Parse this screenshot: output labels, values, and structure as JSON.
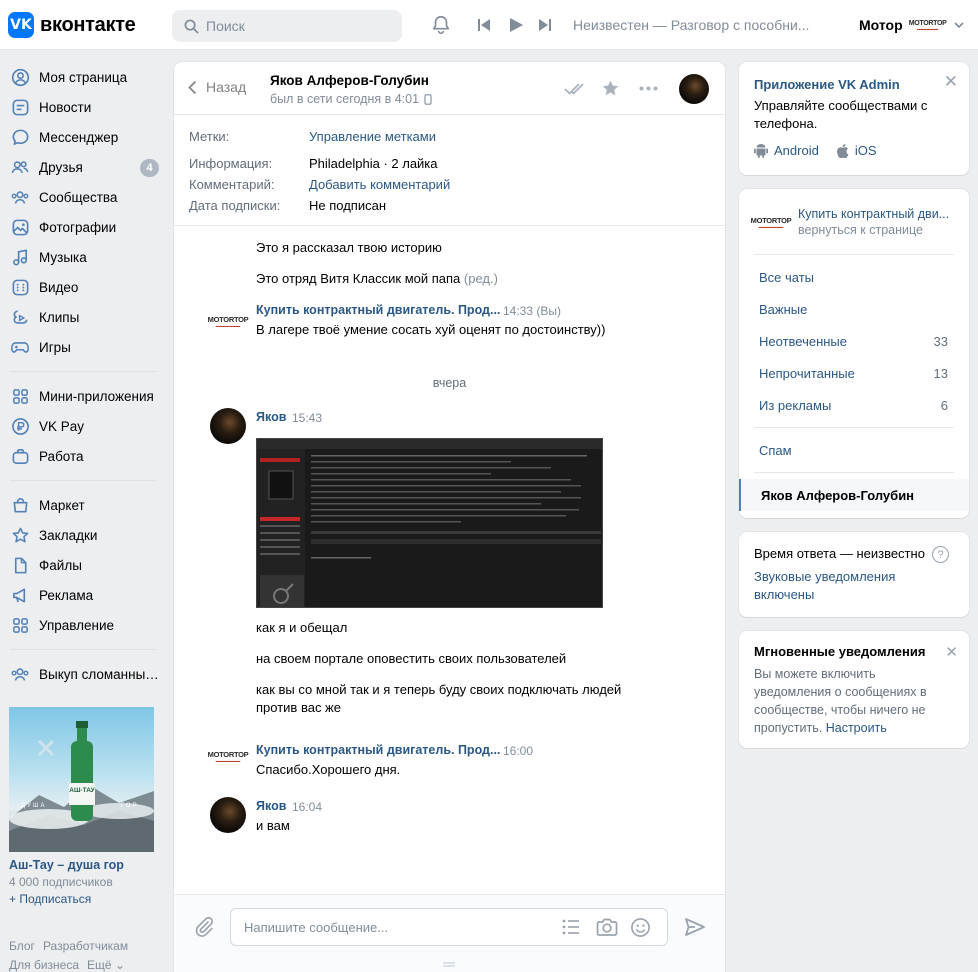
{
  "header": {
    "logo_text": "вконтакте",
    "search_placeholder": "Поиск",
    "track": "Неизвестен — Разговор с пособни...",
    "profile_name": "Мотор"
  },
  "leftnav": {
    "items": [
      {
        "label": "Моя страница",
        "icon": "user-circle-icon"
      },
      {
        "label": "Новости",
        "icon": "news-icon"
      },
      {
        "label": "Мессенджер",
        "icon": "message-icon"
      },
      {
        "label": "Друзья",
        "icon": "friends-icon",
        "badge": "4"
      },
      {
        "label": "Сообщества",
        "icon": "communities-icon"
      },
      {
        "label": "Фотографии",
        "icon": "photos-icon"
      },
      {
        "label": "Музыка",
        "icon": "music-icon"
      },
      {
        "label": "Видео",
        "icon": "video-icon"
      },
      {
        "label": "Клипы",
        "icon": "clips-icon"
      },
      {
        "label": "Игры",
        "icon": "games-icon"
      }
    ],
    "items2": [
      {
        "label": "Мини-приложения",
        "icon": "apps-icon"
      },
      {
        "label": "VK Pay",
        "icon": "vkpay-icon"
      },
      {
        "label": "Работа",
        "icon": "work-icon"
      }
    ],
    "items3": [
      {
        "label": "Маркет",
        "icon": "market-icon"
      },
      {
        "label": "Закладки",
        "icon": "bookmark-icon"
      },
      {
        "label": "Файлы",
        "icon": "file-icon"
      },
      {
        "label": "Реклама",
        "icon": "ads-icon"
      },
      {
        "label": "Управление",
        "icon": "manage-icon"
      }
    ],
    "items4": [
      {
        "label": "Выкуп сломанных...",
        "icon": "communities-icon"
      }
    ]
  },
  "promo": {
    "image_caption_left": "ДУША",
    "image_caption_right": "ГОР",
    "bottle_label": "АШ-ТАУ",
    "title": "Аш-Тау – душа гор",
    "subscribers": "4 000 подписчиков",
    "subscribe": "+ Подписаться"
  },
  "footer": {
    "links": [
      "Блог",
      "Разработчикам",
      "Для бизнеса",
      "Ещё ⌄"
    ]
  },
  "chat": {
    "back": "Назад",
    "peer_name": "Яков Алферов-Голубин",
    "peer_status": "был в сети сегодня в 4:01",
    "info": {
      "tags_label": "Метки:",
      "tags_value": "Управление метками",
      "info_label": "Информация:",
      "info_value": "Philadelphia · 2 лайка",
      "comment_label": "Комментарий:",
      "comment_value": "Добавить комментарий",
      "sub_label": "Дата подписки:",
      "sub_value": "Не подписан"
    },
    "messages": {
      "m1": "Это я рассказал твою историю",
      "m2": "Это отряд Витя Классик мой папа",
      "m2_edited": "(ред.)",
      "author_group": "Купить контрактный двигатель. Прод...",
      "author_logo": "MOTORTOP",
      "t1": "14:33 (Вы)",
      "m3": "В лагере твоё умение сосать хуй оценят по достоинству))",
      "day": "вчера",
      "author_user": "Яков",
      "t2": "15:43",
      "m4": "как я и обещал",
      "m5": "на своем портале оповестить своих пользователей",
      "m6a": "как вы со мной так и я теперь буду своих подключать людей",
      "m6b": "против вас же",
      "t3": "16:00",
      "m7": "Спасибо.Хорошего дня.",
      "t4": "16:04",
      "m8": "и вам"
    },
    "composer_placeholder": "Напишите сообщение..."
  },
  "right": {
    "app": {
      "title": "Приложение VK Admin",
      "text": "Управляйте сообществами с телефона.",
      "android": "Android",
      "ios": "iOS"
    },
    "community": {
      "logo": "MOTORTOP",
      "name": "Купить контрактный дви...",
      "return": "вернуться к странице"
    },
    "filters": [
      {
        "label": "Все чаты",
        "count": ""
      },
      {
        "label": "Важные",
        "count": ""
      },
      {
        "label": "Неотвеченные",
        "count": "33"
      },
      {
        "label": "Непрочитанные",
        "count": "13"
      },
      {
        "label": "Из рекламы",
        "count": "6"
      }
    ],
    "spam": "Спам",
    "active_chat": "Яков Алферов-Голубин",
    "response": {
      "text": "Время ответа — неизвестно",
      "sound": "Звуковые уведомления включены"
    },
    "instant": {
      "title": "Мгновенные уведомления",
      "text": "Вы можете включить уведомления о сообщениях в сообществе, чтобы ничего не пропустить.",
      "link": "Настроить"
    }
  },
  "colors": {
    "accent": "#0077ff",
    "link": "#2a5885",
    "muted": "#818c99"
  }
}
